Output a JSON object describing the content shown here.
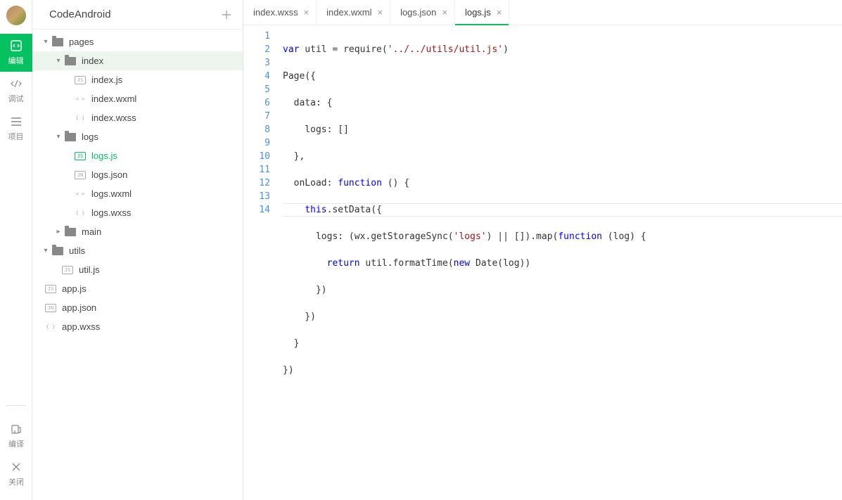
{
  "project_name": "CodeAndroid",
  "left_toolbar": {
    "edit": "编辑",
    "debug": "调试",
    "project": "项目",
    "compile": "编译",
    "close": "关闭"
  },
  "tree": {
    "pages": {
      "label": "pages",
      "expanded": true
    },
    "index": {
      "label": "index",
      "expanded": true
    },
    "index_js": {
      "label": "index.js",
      "badge": "JS"
    },
    "index_wxml": {
      "label": "index.wxml",
      "badge": "< >"
    },
    "index_wxss": {
      "label": "index.wxss",
      "badge": "{ }"
    },
    "logs": {
      "label": "logs",
      "expanded": true
    },
    "logs_js": {
      "label": "logs.js",
      "badge": "JS"
    },
    "logs_json": {
      "label": "logs.json",
      "badge": "JN"
    },
    "logs_wxml": {
      "label": "logs.wxml",
      "badge": "< >"
    },
    "logs_wxss": {
      "label": "logs.wxss",
      "badge": "{ }"
    },
    "main": {
      "label": "main",
      "expanded": false
    },
    "utils": {
      "label": "utils",
      "expanded": true
    },
    "util_js": {
      "label": "util.js",
      "badge": "JS"
    },
    "app_js": {
      "label": "app.js",
      "badge": "JS"
    },
    "app_json": {
      "label": "app.json",
      "badge": "JN"
    },
    "app_wxss": {
      "label": "app.wxss",
      "badge": "{ }"
    }
  },
  "tabs": [
    {
      "label": "index.wxss"
    },
    {
      "label": "index.wxml"
    },
    {
      "label": "logs.json"
    },
    {
      "label": "logs.js",
      "active": true
    }
  ],
  "code": {
    "lines": [
      1,
      2,
      3,
      4,
      5,
      6,
      7,
      8,
      9,
      10,
      11,
      12,
      13,
      14
    ],
    "l1_kw": "var",
    "l1_a": " util = require(",
    "l1_s": "'../../utils/util.js'",
    "l1_b": ")",
    "l2": "Page({",
    "l3": "  data: {",
    "l4": "    logs: []",
    "l5": "  },",
    "l6_a": "  onLoad: ",
    "l6_kw": "function",
    "l6_b": " () {",
    "l7_a": "    ",
    "l7_kw": "this",
    "l7_b": ".setData({",
    "l8_a": "      logs: (wx.getStorageSync(",
    "l8_s": "'logs'",
    "l8_b": ") || []).map(",
    "l8_kw": "function",
    "l8_c": " (log) {",
    "l9_a": "        ",
    "l9_kw": "return",
    "l9_b": " util.formatTime(",
    "l9_kw2": "new",
    "l9_c": " Date(log))",
    "l10": "      })",
    "l11": "    })",
    "l12": "  }",
    "l13": "})"
  }
}
